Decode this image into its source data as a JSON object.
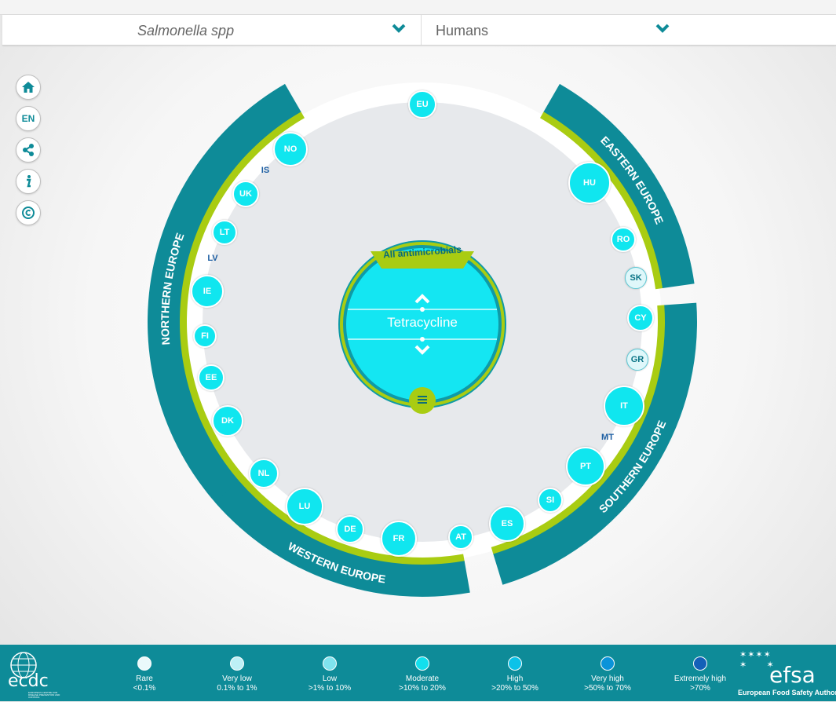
{
  "selectors": {
    "pathogen": "Salmonella spp",
    "host": "Humans"
  },
  "sidebar": {
    "language": "EN",
    "icons": [
      "home-icon",
      "language-button",
      "share-icon",
      "info-icon",
      "copyright-icon"
    ]
  },
  "regions": {
    "northern": "NORTHERN EUROPE",
    "eastern": "EASTERN EUROPE",
    "southern": "SOUTHERN EUROPE",
    "western": "WESTERN EUROPE"
  },
  "center": {
    "group": "All antimicrobials",
    "antimicrobial": "Tetracycline"
  },
  "countries": {
    "EU": "EU",
    "NO": "NO",
    "IS": "IS",
    "UK": "UK",
    "LT": "LT",
    "LV": "LV",
    "IE": "IE",
    "FI": "FI",
    "EE": "EE",
    "DK": "DK",
    "NL": "NL",
    "LU": "LU",
    "DE": "DE",
    "FR": "FR",
    "AT": "AT",
    "ES": "ES",
    "SI": "SI",
    "PT": "PT",
    "MT": "MT",
    "IT": "IT",
    "GR": "GR",
    "CY": "CY",
    "SK": "SK",
    "RO": "RO",
    "HU": "HU"
  },
  "legend": [
    {
      "label": "Rare",
      "range": "<0.1%",
      "color": "#eaf9fb"
    },
    {
      "label": "Very low",
      "range": "0.1% to 1%",
      "color": "#bdf0f6"
    },
    {
      "label": "Low",
      "range": ">1% to 10%",
      "color": "#7fe3ee"
    },
    {
      "label": "Moderate",
      "range": ">10% to 20%",
      "color": "#12e0ee"
    },
    {
      "label": "High",
      "range": ">20% to 50%",
      "color": "#0cc2e8"
    },
    {
      "label": "Very high",
      "range": ">50% to 70%",
      "color": "#0a93d9"
    },
    {
      "label": "Extremely high",
      "range": ">70%",
      "color": "#1460b8"
    }
  ],
  "logos": {
    "ecdc": "ecdc",
    "ecdc_sub": "EUROPEAN CENTRE FOR DISEASE PREVENTION AND CONTROL",
    "efsa": "efsa",
    "efsa_sub": "European Food Safety Authority"
  }
}
